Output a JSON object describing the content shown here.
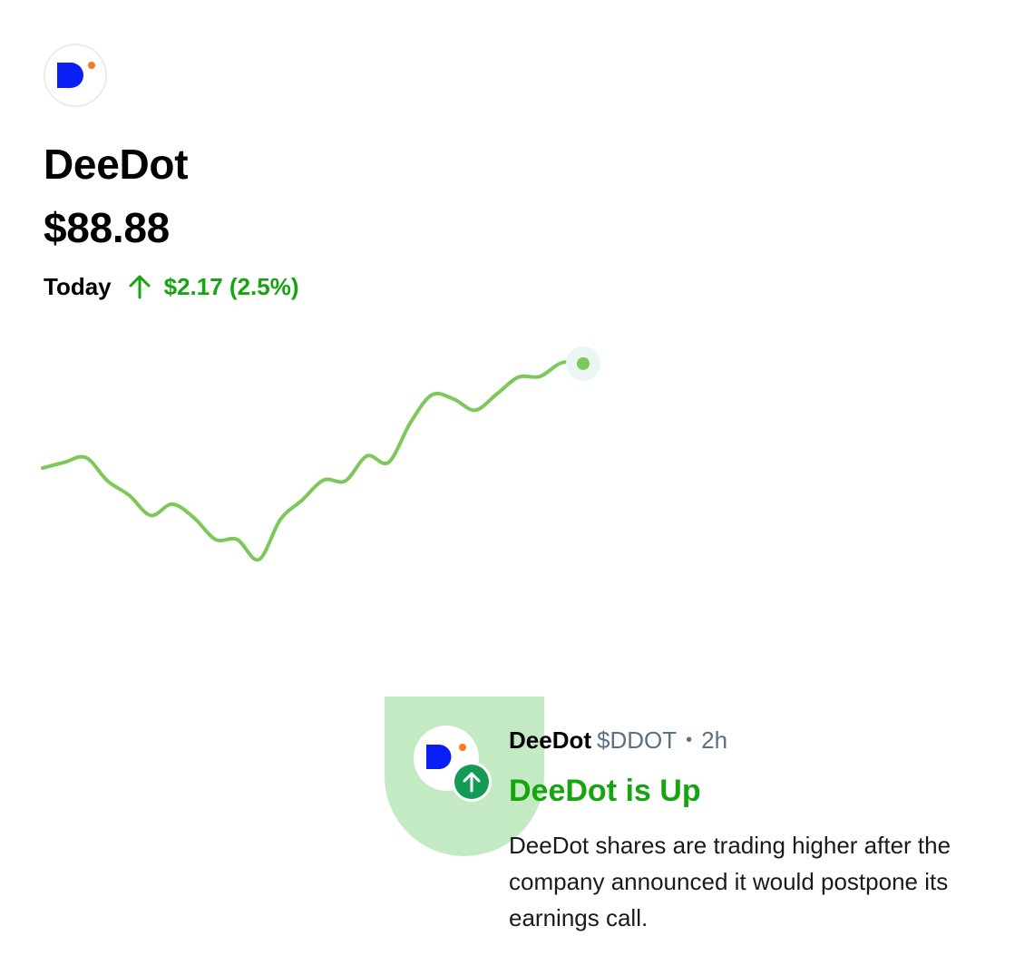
{
  "header": {
    "logo_icon": "deedot-logo-icon",
    "company_name": "DeeDot",
    "price": "$88.88",
    "today_label": "Today",
    "change_icon": "arrow-up-icon",
    "change_text": "$2.17 (2.5%)"
  },
  "colors": {
    "accent_green": "#16a510",
    "chart_line": "#7cc85a",
    "brand_blue": "#0a1ff5",
    "brand_orange": "#f47b20",
    "badge_green": "#139a55",
    "notification_bg": "#c4eac4",
    "muted_text": "#5b7088"
  },
  "chart_data": {
    "type": "line",
    "title": "",
    "xlabel": "",
    "ylabel": "",
    "grid": false,
    "series": [
      {
        "values": [
          86.71,
          86.78,
          86.84,
          86.55,
          86.37,
          86.12,
          86.26,
          86.09,
          85.82,
          85.82,
          85.57,
          86.07,
          86.31,
          86.56,
          86.55,
          86.86,
          86.78,
          87.27,
          87.62,
          87.57,
          87.43,
          87.63,
          87.84,
          87.85,
          88.02,
          88.01
        ]
      }
    ]
  },
  "notification": {
    "logo_icon": "deedot-logo-icon",
    "badge_icon": "arrow-up-circle-icon",
    "company": "DeeDot",
    "ticker": "$DDOT",
    "separator": "•",
    "time": "2h",
    "title": "DeeDot is Up",
    "body": "DeeDot shares are trading higher after the company announced it would postpone its earnings call."
  }
}
